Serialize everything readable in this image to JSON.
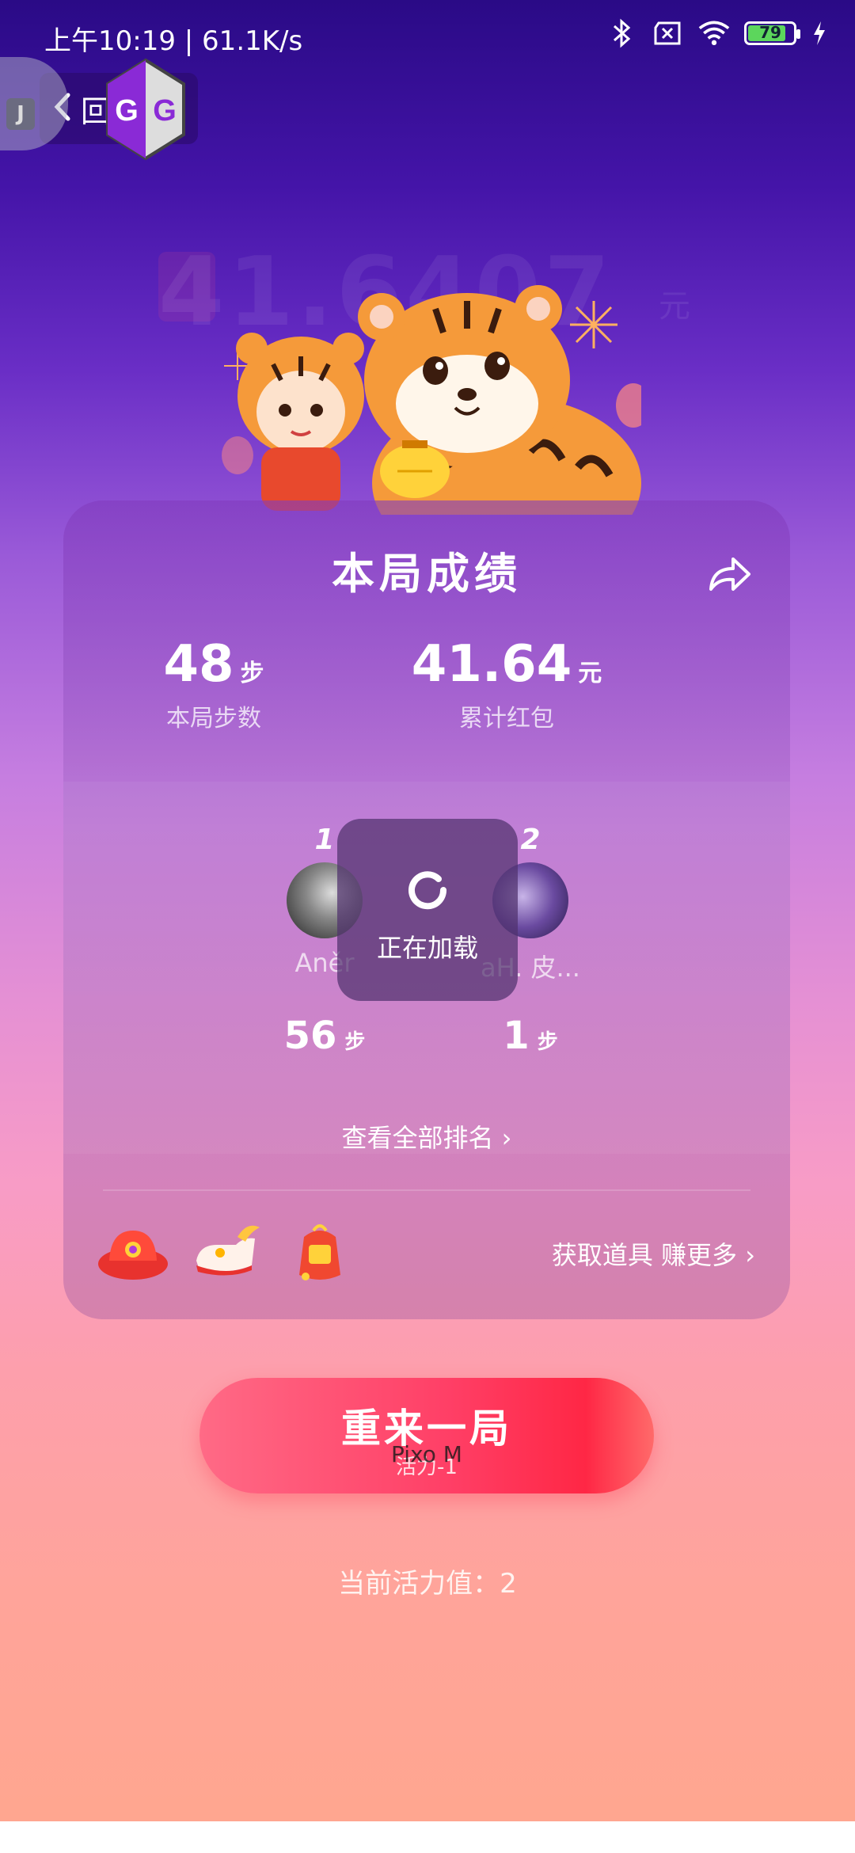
{
  "status_bar": {
    "time": "上午10:19 | 61.1K/s",
    "battery_level": "79",
    "icons": [
      "bluetooth-icon",
      "sim-off-icon",
      "wifi-icon",
      "battery-icon",
      "charging-icon"
    ]
  },
  "nav": {
    "back_label": "回",
    "floating_badge_letter": "J"
  },
  "header": {
    "faded_amount": "41.6407",
    "faded_unit": "元"
  },
  "card": {
    "title": "本局成绩",
    "stats": [
      {
        "value": "48",
        "unit": "步",
        "label": "本局步数"
      },
      {
        "value": "41.64",
        "unit": "元",
        "label": "累计红包"
      }
    ],
    "ranking": [
      {
        "rank": "1",
        "name": "Aněr",
        "steps": "56",
        "unit": "步"
      },
      {
        "rank": "2",
        "name": "aH. 皮...",
        "steps": "1",
        "unit": "步"
      }
    ],
    "view_all": "查看全部排名 ›",
    "get_props": "获取道具  赚更多  ›",
    "props": [
      "lantern-hat-icon",
      "lucky-shoe-icon",
      "red-envelope-bag-icon"
    ]
  },
  "loading": {
    "text": "正在加载"
  },
  "replay": {
    "label": "重来一局",
    "cost": "活力-1",
    "overlay_text": "Pixo M"
  },
  "vitality": "当前活力值：2",
  "colors": {
    "accent_red": "#ff3f66",
    "bg_top": "#2a0a86",
    "bg_bottom": "#ffa68e"
  }
}
